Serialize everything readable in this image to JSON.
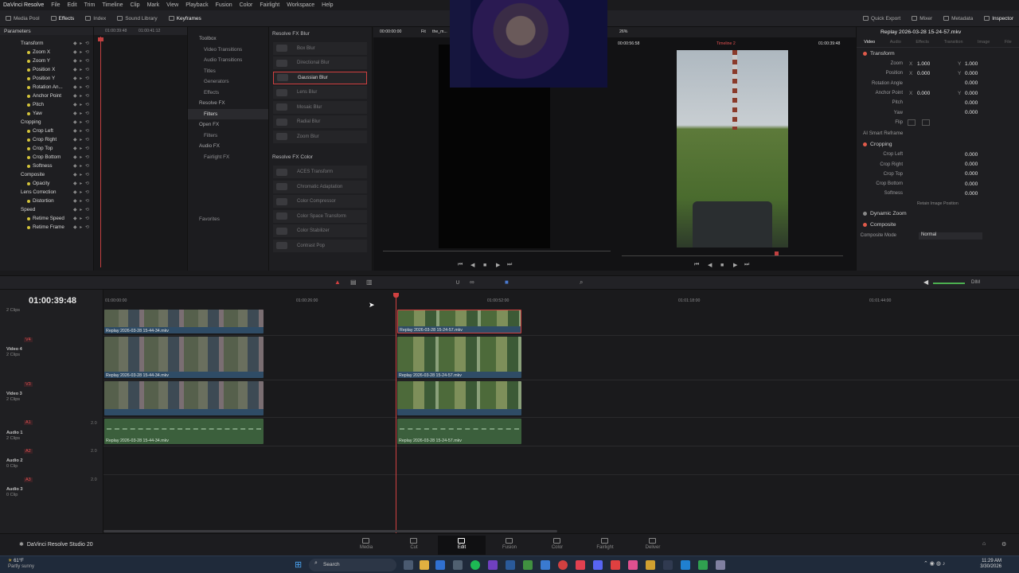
{
  "app": {
    "title": "DaVinci Resolve",
    "studio_label": "DaVinci Resolve Studio 20"
  },
  "menu": [
    "File",
    "Edit",
    "Trim",
    "Timeline",
    "Clip",
    "Mark",
    "View",
    "Playback",
    "Fusion",
    "Color",
    "Fairlight",
    "Workspace",
    "Help"
  ],
  "toolbar": {
    "left": [
      "Media Pool",
      "Effects",
      "Index",
      "Sound Library",
      "Keyframes"
    ],
    "right": [
      "Quick Export",
      "Mixer",
      "Metadata",
      "Inspector"
    ]
  },
  "keyframes": {
    "header": "Parameters",
    "rows": [
      {
        "label": "Transform",
        "group": true
      },
      {
        "label": "Zoom X"
      },
      {
        "label": "Zoom Y"
      },
      {
        "label": "Position X"
      },
      {
        "label": "Position Y"
      },
      {
        "label": "Rotation An..."
      },
      {
        "label": "Anchor Point"
      },
      {
        "label": "Pitch"
      },
      {
        "label": "Yaw"
      },
      {
        "label": "Cropping",
        "group": true
      },
      {
        "label": "Crop Left"
      },
      {
        "label": "Crop Right"
      },
      {
        "label": "Crop Top"
      },
      {
        "label": "Crop Bottom"
      },
      {
        "label": "Softness"
      },
      {
        "label": "Composite",
        "group": true
      },
      {
        "label": "Opacity"
      },
      {
        "label": "Lens Correction",
        "group": true
      },
      {
        "label": "Distortion"
      },
      {
        "label": "Speed",
        "group": true
      },
      {
        "label": "Retime Speed"
      },
      {
        "label": "Retime Frame"
      }
    ],
    "ruler": [
      "01:00:39:48",
      "01:00:41:12"
    ]
  },
  "toolbox": {
    "items": [
      {
        "label": "Toolbox",
        "hdr": true
      },
      {
        "label": "Video Transitions"
      },
      {
        "label": "Audio Transitions"
      },
      {
        "label": "Titles"
      },
      {
        "label": "Generators"
      },
      {
        "label": "Effects"
      },
      {
        "label": "Resolve FX",
        "hdr": true
      },
      {
        "label": "Filters",
        "sel": true
      },
      {
        "label": "Open FX",
        "hdr": true
      },
      {
        "label": "Filters"
      },
      {
        "label": "Audio FX",
        "hdr": true
      },
      {
        "label": "Fairlight FX"
      }
    ],
    "favorites": "Favorites"
  },
  "fx": {
    "blur_header": "Resolve FX Blur",
    "blur": [
      "Box Blur",
      "Directional Blur",
      "Gaussian Blur",
      "Lens Blur",
      "Mosaic Blur",
      "Radial Blur",
      "Zoom Blur"
    ],
    "selected": "Gaussian Blur",
    "color_header": "Resolve FX Color",
    "color": [
      "ACES Transform",
      "Chromatic Adaptation",
      "Color Compressor",
      "Color Space Transform",
      "Color Stabilizer",
      "Contrast Pop"
    ]
  },
  "viewer": {
    "left_tc": "00:00:00:00",
    "left_name": "the_m...",
    "fit": "Fit",
    "zoom": "26%",
    "right_dur": "00:00:56:58",
    "timeline_name": "Timeline 2",
    "right_tc": "01:00:39:48"
  },
  "inspector": {
    "clip_title": "Replay 2026-03-28 15-24-57.mkv",
    "tabs": [
      "Video",
      "Audio",
      "Effects",
      "Transition",
      "Image",
      "File"
    ],
    "transform_header": "Transform",
    "zoom": {
      "label": "Zoom",
      "x": "1.000",
      "y": "1.000"
    },
    "position": {
      "label": "Position",
      "x": "0.000",
      "y": "0.000"
    },
    "rotation": {
      "label": "Rotation Angle",
      "value": "0.000"
    },
    "anchor": {
      "label": "Anchor Point",
      "x": "0.000",
      "y": "0.000"
    },
    "pitch": {
      "label": "Pitch",
      "value": "0.000"
    },
    "yaw": {
      "label": "Yaw",
      "value": "0.000"
    },
    "flip": "Flip",
    "smart_reframe": "AI Smart Reframe",
    "cropping_header": "Cropping",
    "crop": [
      {
        "label": "Crop Left",
        "value": "0.000"
      },
      {
        "label": "Crop Right",
        "value": "0.000"
      },
      {
        "label": "Crop Top",
        "value": "0.000"
      },
      {
        "label": "Crop Bottom",
        "value": "0.000"
      },
      {
        "label": "Softness",
        "value": "0.000"
      }
    ],
    "retain": "Retain Image Position",
    "dynamic_zoom": "Dynamic Zoom",
    "composite_header": "Composite",
    "composite_mode_label": "Composite Mode",
    "composite_mode": "Normal",
    "axis_x": "X",
    "axis_y": "Y"
  },
  "timeline": {
    "timecode": "01:00:39:48",
    "ruler": [
      "01:00:00:00",
      "01:00:26:00",
      "01:00:52:00",
      "01:01:18:00",
      "01:01:44:00"
    ],
    "tracks": [
      {
        "name": "",
        "clips": "2 Clips"
      },
      {
        "id": "V4",
        "name": "Video 4",
        "clips": "2 Clips"
      },
      {
        "id": "V3",
        "name": "Video 3",
        "clips": "2 Clips"
      },
      {
        "id": "A1",
        "name": "Audio 1",
        "clips": "2 Clips",
        "level": "2.0"
      },
      {
        "id": "A2",
        "name": "Audio 2",
        "clips": "0 Clip",
        "level": "2.0"
      },
      {
        "id": "A3",
        "name": "Audio 3",
        "clips": "0 Clip",
        "level": "2.0"
      }
    ],
    "clip_a": "Replay 2026-03-28 15-44-34.mkv",
    "clip_b": "Replay 2026-03-28 15-24-57.mkv",
    "dim": "DIM"
  },
  "pages": [
    "Media",
    "Cut",
    "Edit",
    "Fusion",
    "Color",
    "Fairlight",
    "Deliver"
  ],
  "active_page": "Edit",
  "taskbar": {
    "weather_temp": "61°F",
    "weather_desc": "Partly sunny",
    "search": "Search",
    "time": "11:29 AM",
    "date": "3/30/2026"
  }
}
